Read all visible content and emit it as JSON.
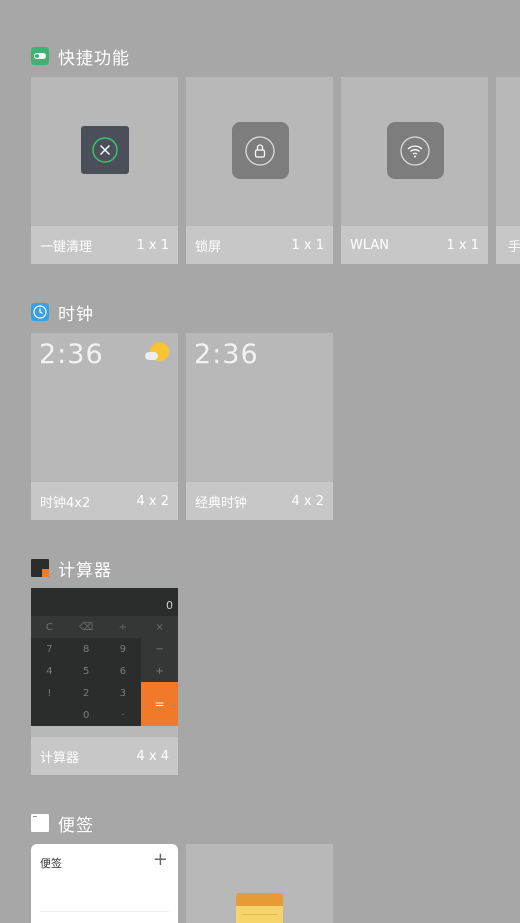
{
  "sections": {
    "quick": {
      "title": "快捷功能",
      "icon": "toggle-icon",
      "color": "#3cb371",
      "cards": [
        {
          "label": "一键清理",
          "size": "1 x 1",
          "icon": "close-circle-icon"
        },
        {
          "label": "锁屏",
          "size": "1 x 1",
          "icon": "lock-icon"
        },
        {
          "label": "WLAN",
          "size": "1 x 1",
          "icon": "wifi-icon"
        },
        {
          "label": "手",
          "size": "",
          "icon": ""
        }
      ]
    },
    "clock": {
      "title": "时钟",
      "icon": "clock-icon",
      "color": "#3aa0e6",
      "cards": [
        {
          "label": "时钟4x2",
          "size": "4 x 2",
          "time": "2:36",
          "icon": "weather-sun-cloud-icon"
        },
        {
          "label": "经典时钟",
          "size": "4 x 2",
          "time": "2:36"
        }
      ]
    },
    "calculator": {
      "title": "计算器",
      "icon": "calculator-icon",
      "card": {
        "label": "计算器",
        "size": "4 x 4",
        "display": "0",
        "keys": [
          "C",
          "⌫",
          "÷",
          "×",
          "7",
          "8",
          "9",
          "−",
          "4",
          "5",
          "6",
          "+",
          "1",
          "2",
          "3",
          "!",
          "0",
          "·"
        ],
        "equals": "="
      }
    },
    "notes": {
      "title": "便签",
      "icon": "note-icon",
      "card": {
        "title": "便签",
        "add": "+"
      }
    }
  }
}
